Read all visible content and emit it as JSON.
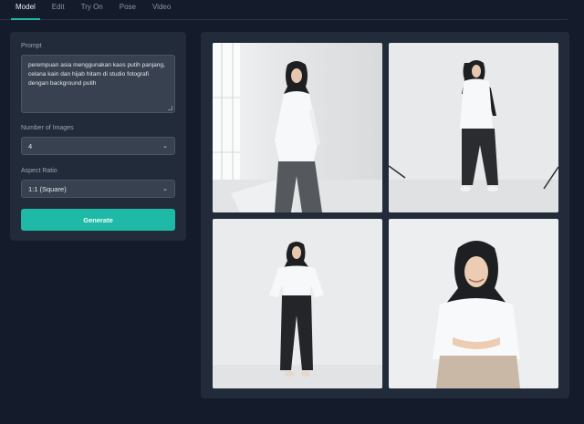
{
  "tabs": [
    {
      "label": "Model",
      "active": true
    },
    {
      "label": "Edit",
      "active": false
    },
    {
      "label": "Try On",
      "active": false
    },
    {
      "label": "Pose",
      "active": false
    },
    {
      "label": "Video",
      "active": false
    }
  ],
  "form": {
    "prompt_label": "Prompt",
    "prompt_value": "perempuan asia menggunakan kaos putih panjang, celana kain dan hijab hitam di studio fotografi dengan background putih",
    "num_images_label": "Number of Images",
    "num_images_value": "4",
    "aspect_ratio_label": "Aspect Ratio",
    "aspect_ratio_value": "1:1 (Square)",
    "generate_label": "Generate"
  },
  "gallery": {
    "images": [
      {
        "subject": "woman in white long-sleeve shirt, grey trousers, black hijab by window"
      },
      {
        "subject": "woman in white shirt, black pants, black hijab in studio with lights"
      },
      {
        "subject": "woman in white shirt, black pants, black hijab, full body"
      },
      {
        "subject": "smiling woman in white shirt, beige trousers, black hijab"
      }
    ]
  },
  "colors": {
    "accent": "#1fb9a7",
    "background": "#141c2b",
    "panel": "#222b3a"
  }
}
